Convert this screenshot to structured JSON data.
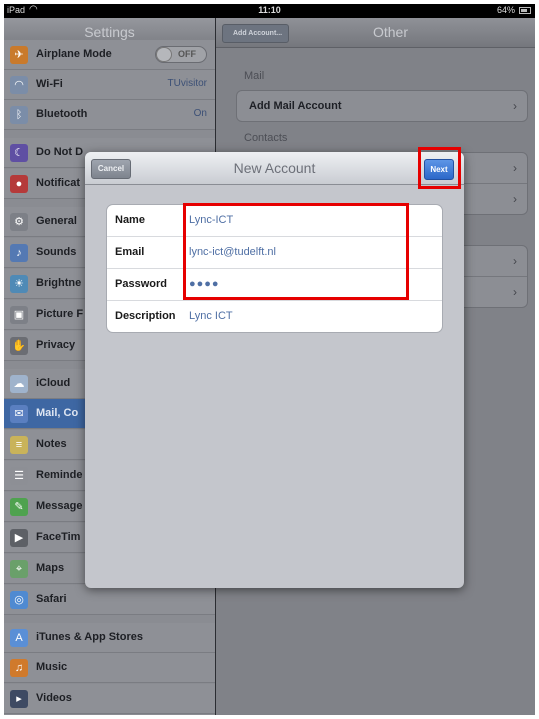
{
  "status_bar": {
    "carrier": "iPad",
    "time": "11:10",
    "battery": "64%"
  },
  "left_pane": {
    "title": "Settings",
    "items": [
      {
        "label": "Airplane Mode",
        "toggle": "OFF",
        "icon": "airplane-icon",
        "color": "#c97a2c"
      },
      {
        "label": "Wi-Fi",
        "value": "TUvisitor",
        "icon": "wifi-icon",
        "color": "#7b8da8"
      },
      {
        "label": "Bluetooth",
        "value": "On",
        "icon": "bluetooth-icon",
        "color": "#7b8da8"
      },
      {
        "label": "Do Not D",
        "icon": "moon-icon",
        "color": "#5f4fa3"
      },
      {
        "label": "Notificat",
        "icon": "notifications-icon",
        "color": "#b53a3a"
      },
      {
        "label": "General",
        "icon": "gear-icon",
        "color": "#7d8087"
      },
      {
        "label": "Sounds",
        "icon": "speaker-icon",
        "color": "#5479b3"
      },
      {
        "label": "Brightne",
        "icon": "brightness-icon",
        "color": "#4f8ab6"
      },
      {
        "label": "Picture F",
        "icon": "picture-frame-icon",
        "color": "#7d8087"
      },
      {
        "label": "Privacy",
        "icon": "hand-icon",
        "color": "#6b6d73"
      },
      {
        "label": "iCloud",
        "icon": "cloud-icon",
        "color": "#9fb3cc"
      },
      {
        "label": "Mail, Co",
        "icon": "mail-icon",
        "color": "#5a7fc0",
        "selected": true
      },
      {
        "label": "Notes",
        "icon": "notes-icon",
        "color": "#c9b35a"
      },
      {
        "label": "Reminde",
        "icon": "reminders-icon",
        "color": "#8d8f95"
      },
      {
        "label": "Message",
        "icon": "messages-icon",
        "color": "#4fa24f"
      },
      {
        "label": "FaceTim",
        "icon": "facetime-icon",
        "color": "#5d6066"
      },
      {
        "label": "Maps",
        "icon": "maps-icon",
        "color": "#6aa06a"
      },
      {
        "label": "Safari",
        "icon": "safari-icon",
        "color": "#4f8ad1"
      },
      {
        "label": "iTunes & App Stores",
        "icon": "app-store-icon",
        "color": "#5a8fd6"
      },
      {
        "label": "Music",
        "icon": "music-icon",
        "color": "#d07a2c"
      },
      {
        "label": "Videos",
        "icon": "videos-icon",
        "color": "#3e4a63"
      }
    ]
  },
  "right_pane": {
    "back_label": "Add Account...",
    "title": "Other",
    "mail_section": "Mail",
    "add_mail": "Add Mail Account",
    "contacts_section": "Contacts"
  },
  "modal": {
    "cancel_label": "Cancel",
    "title": "New Account",
    "next_label": "Next",
    "fields": [
      {
        "label": "Name",
        "value": "Lync-ICT"
      },
      {
        "label": "Email",
        "value": "lync-ict@tudelft.nl"
      },
      {
        "label": "Password",
        "value": "●●●●"
      },
      {
        "label": "Description",
        "value": "Lync ICT"
      }
    ]
  },
  "colors": {
    "highlight": "#e60000",
    "accent": "#2c68c9"
  }
}
